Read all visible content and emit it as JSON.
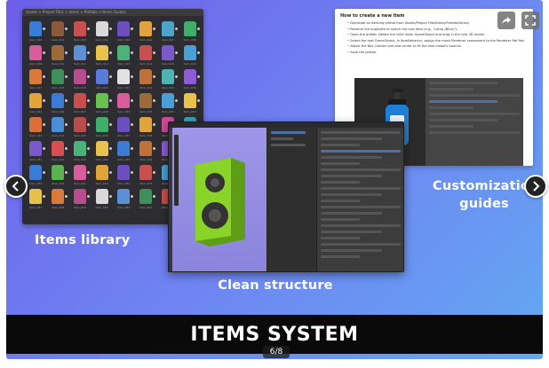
{
  "slide": {
    "title": "ITEMS SYSTEM",
    "counter": "6/8",
    "captions": {
      "library": "Items library",
      "structure": "Clean structure",
      "guides_line1": "Customization",
      "guides_line2": "guides"
    }
  },
  "guide": {
    "heading": "How to create a new item",
    "steps": [
      "Duplicate an existing prefab from Assets/Project Files/Items/Prefabs/Items/.",
      "Rename the duplicate to match the new item (e.g., \"Lamp (Blue)\").",
      "Open the prefab. Delete the child mesh GameObject and drag in the new 3D model.",
      "Select the root GameObject. In ItemBehavior, assign the mesh Renderer component to the Renderer Ref field.",
      "Adjust the Box Collider size and center to fit the new model's bounds.",
      "Save the prefab."
    ]
  },
  "library": {
    "breadcrumb": "Assets > Project Files > Items > Prefabs > Items Guides",
    "thumb_colors": [
      "#3a7bd5",
      "#8a5a3b",
      "#c94f4f",
      "#d9d9d9",
      "#6b4fbf",
      "#e0a43a",
      "#4fa3c9",
      "#3fae6b",
      "#d95d9b",
      "#9c6b3a",
      "#5c8fd6",
      "#e8c24a",
      "#4ab37a",
      "#c94f4f",
      "#7a5acb",
      "#4aa0d6",
      "#d97a3a",
      "#3f8f5a",
      "#b84c8c",
      "#5a7bd9",
      "#e2e2e2",
      "#c2703a",
      "#4fb3b3",
      "#8f5ad6",
      "#e0a43a",
      "#3a7bd5",
      "#c94f4f",
      "#6bbf4f",
      "#d95d9b",
      "#9c6b3a",
      "#4aa0d6",
      "#e8c24a",
      "#d9703a",
      "#4a8fd6",
      "#b84c4c",
      "#3fae6b",
      "#6b4fbf",
      "#e0a43a",
      "#c94f9b",
      "#3aa0b3",
      "#7a5acb",
      "#d94f4f",
      "#4ab37a",
      "#e8c24a",
      "#3a7bd5",
      "#c2703a",
      "#8f5ad6",
      "#4fb3b3",
      "#3a7bd5",
      "#5ab34f",
      "#d95d9b",
      "#e0a43a",
      "#6b4fbf",
      "#c94f4f",
      "#4aa0d6",
      "#9c6b3a",
      "#e2c24a",
      "#d97a3a",
      "#b84c8c",
      "#d9d9d9",
      "#5c8fd6",
      "#3f8f5a",
      "#c94f4f",
      "#7a5acb"
    ],
    "item_names": [
      "item_001",
      "item_002",
      "item_003",
      "item_004",
      "item_005",
      "item_006",
      "item_007",
      "item_008",
      "item_009",
      "item_010",
      "item_011",
      "item_012",
      "item_013",
      "item_014",
      "item_015",
      "item_016",
      "item_017",
      "item_018",
      "item_019",
      "item_020",
      "item_021",
      "item_022",
      "item_023",
      "item_024",
      "item_025",
      "item_026",
      "item_027",
      "item_028",
      "item_029",
      "item_030",
      "item_031",
      "item_032",
      "item_033",
      "item_034",
      "item_035",
      "item_036",
      "item_037",
      "item_038",
      "item_039",
      "item_040",
      "item_041",
      "item_042",
      "item_043",
      "item_044",
      "item_045",
      "item_046",
      "item_047",
      "item_048",
      "item_049",
      "item_050",
      "item_051",
      "item_052",
      "item_053",
      "item_054",
      "item_055",
      "item_056",
      "item_057",
      "item_058",
      "item_059",
      "item_060",
      "item_061",
      "item_062",
      "item_063",
      "item_064"
    ]
  },
  "colors": {
    "speaker": "#8ad42a",
    "speaker_dark": "#5f9d16",
    "bottle": "#1e7fd6",
    "bg_start": "#6d5ee8",
    "bg_end": "#62a8f2"
  },
  "icons": {
    "prev": "chevron-left-icon",
    "next": "chevron-right-icon",
    "share": "share-icon",
    "fullscreen": "fullscreen-icon"
  }
}
